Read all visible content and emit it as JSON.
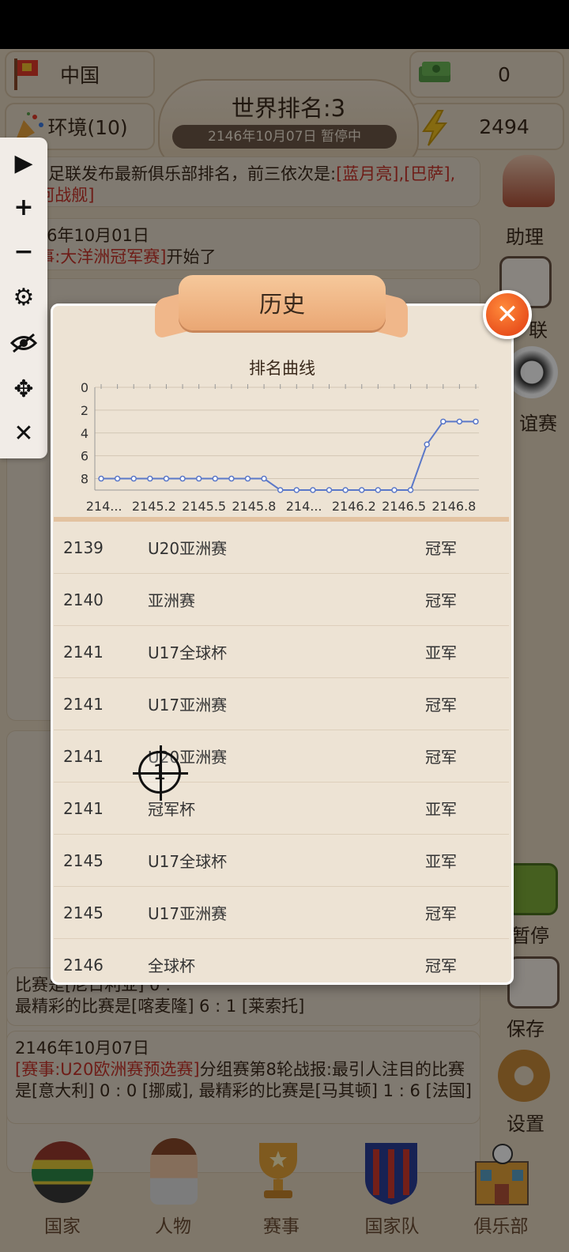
{
  "top": {
    "country": "中国",
    "money": "0",
    "environment": "环境(10)",
    "energy": "2494",
    "world_rank": "世界排名:3",
    "date_status": "2146年10月07日  暂停中"
  },
  "feed": [
    {
      "date": "",
      "pre": "国际足联发布最新俱乐部排名，前三依次是:",
      "red": "[蓝月亮],[巴萨],[银河战舰]",
      "post": ""
    },
    {
      "date": "2146年10月01日",
      "pre": "",
      "red": "[赛事:大洋洲冠军赛]",
      "post": "开始了"
    },
    {
      "date": "2146年10月07日",
      "pre": "",
      "red": "[赛事:U20欧洲赛预选赛]",
      "post": "分组赛第8轮战报:最引人注目的比赛是[意大利] 0 : 0 [挪威], 最精彩的比赛是[马其顿] 1 : 6 [法国]"
    },
    {
      "date": "",
      "pre": "比赛是[尼日利亚] 0 :",
      "red": "",
      "post": "最精彩的比赛是[喀麦隆] 6 : 1 [莱索托]"
    }
  ],
  "side_menu": [
    "助理",
    "联",
    "谊赛",
    "暂停",
    "保存",
    "设置"
  ],
  "toolbar": [
    "play",
    "add",
    "minus",
    "settings",
    "hide",
    "move",
    "close"
  ],
  "modal": {
    "title": "历史",
    "chart_title": "排名曲线",
    "close_label": "✕"
  },
  "chart_data": {
    "type": "line",
    "title": "排名曲线",
    "ylim": [
      0,
      8
    ],
    "y_ticks": [
      0,
      2,
      4,
      6,
      8
    ],
    "y_inverted": true,
    "x_tick_labels": [
      "214...",
      "2145.2",
      "2145.5",
      "2145.8",
      "214...",
      "2146.2",
      "2146.5",
      "2146.8"
    ],
    "values": [
      8,
      8,
      8,
      8,
      8,
      8,
      8,
      8,
      8,
      8,
      8,
      9,
      9,
      9,
      9,
      9,
      9,
      9,
      9,
      9,
      5,
      3,
      3,
      3
    ],
    "color": "#5b78c8",
    "grid": true
  },
  "history": [
    {
      "year": "2139",
      "event": "U20亚洲赛",
      "result": "冠军"
    },
    {
      "year": "2140",
      "event": "亚洲赛",
      "result": "冠军"
    },
    {
      "year": "2141",
      "event": "U17全球杯",
      "result": "亚军"
    },
    {
      "year": "2141",
      "event": "U17亚洲赛",
      "result": "冠军"
    },
    {
      "year": "2141",
      "event": "U20亚洲赛",
      "result": "冠军"
    },
    {
      "year": "2141",
      "event": "冠军杯",
      "result": "亚军"
    },
    {
      "year": "2145",
      "event": "U17全球杯",
      "result": "亚军"
    },
    {
      "year": "2145",
      "event": "U17亚洲赛",
      "result": "冠军"
    },
    {
      "year": "2146",
      "event": "全球杯",
      "result": "冠军"
    }
  ],
  "bottom_nav": [
    "国家",
    "人物",
    "赛事",
    "国家队",
    "俱乐部"
  ],
  "crosshair": {
    "label": "1"
  }
}
